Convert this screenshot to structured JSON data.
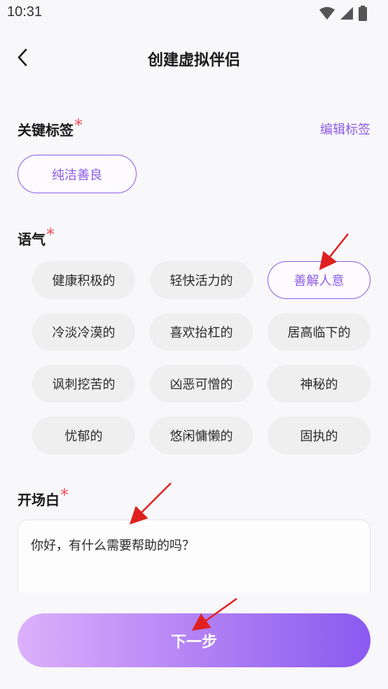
{
  "status": {
    "time": "10:31"
  },
  "header": {
    "title": "创建虚拟伴侣"
  },
  "tags": {
    "label": "关键标签",
    "required_mark": "*",
    "edit_label": "编辑标签",
    "selected": "纯洁善良"
  },
  "tone": {
    "label": "语气",
    "required_mark": "*",
    "selected": "善解人意",
    "options": [
      "健康积极的",
      "轻快活力的",
      "善解人意",
      "冷淡冷漠的",
      "喜欢抬杠的",
      "居高临下的",
      "讽刺挖苦的",
      "凶恶可憎的",
      "神秘的",
      "忧郁的",
      "悠闲慵懒的",
      "固执的"
    ]
  },
  "greeting": {
    "label": "开场白",
    "required_mark": "*",
    "value": "你好，有什么需要帮助的吗？"
  },
  "footer": {
    "next_label": "下一步"
  },
  "colors": {
    "accent": "#8e5be8",
    "required": "#ef4b5a",
    "annotation": "#e02020"
  }
}
